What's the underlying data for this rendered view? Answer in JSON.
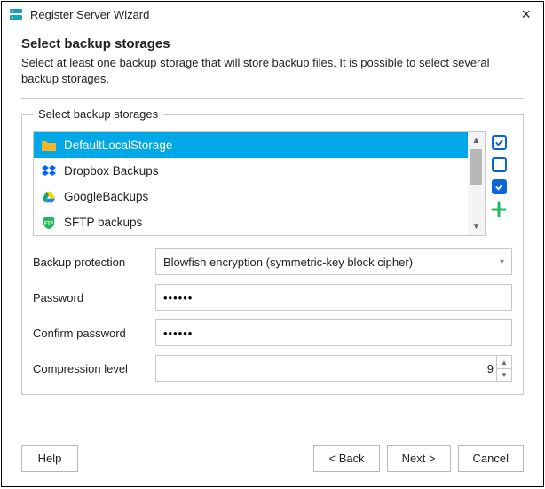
{
  "window": {
    "title": "Register Server Wizard"
  },
  "page": {
    "heading": "Select backup storages",
    "description": "Select at least one backup storage that will store backup files. It is possible to select several backup storages."
  },
  "group": {
    "title": "Select backup storages",
    "items": [
      {
        "label": "DefaultLocalStorage",
        "icon": "folder",
        "selected": true
      },
      {
        "label": "Dropbox Backups",
        "icon": "dropbox",
        "selected": false
      },
      {
        "label": "GoogleBackups",
        "icon": "gdrive",
        "selected": false
      },
      {
        "label": "SFTP backups",
        "icon": "shield",
        "selected": false
      }
    ],
    "checks": {
      "select_all": true,
      "deselect_all": false,
      "invert": true
    }
  },
  "form": {
    "protection_label": "Backup protection",
    "protection_value": "Blowfish encryption (symmetric-key block cipher)",
    "password_label": "Password",
    "password_value": "••••••",
    "confirm_label": "Confirm password",
    "confirm_value": "••••••",
    "compression_label": "Compression level",
    "compression_value": "9"
  },
  "footer": {
    "help": "Help",
    "back": "< Back",
    "next": "Next >",
    "cancel": "Cancel"
  }
}
